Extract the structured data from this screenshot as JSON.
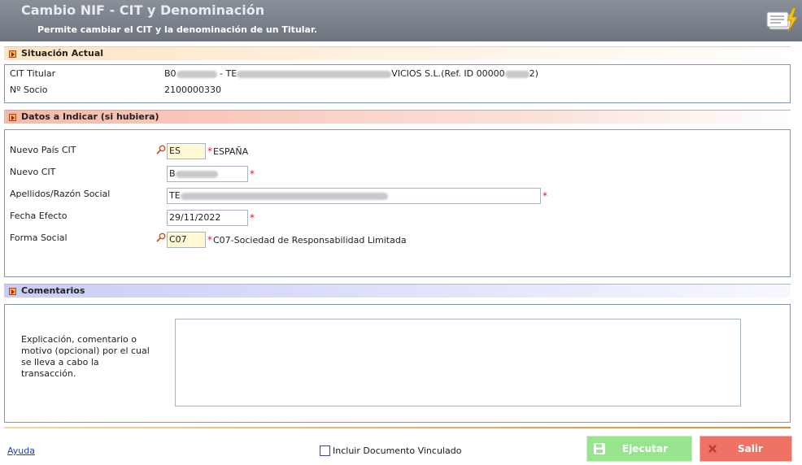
{
  "header": {
    "title": "Cambio NIF - CIT y Denominación",
    "subtitle": "Permite cambiar el CIT y la denominación de un Titular."
  },
  "situacion": {
    "title": "Situación Actual",
    "cit_label": "CIT Titular",
    "cit_value_a": "B0",
    "cit_value_b": " - TE",
    "cit_value_c": "VICIOS S.L.(Ref. ID 00000",
    "cit_value_d": "2)",
    "socio_label": "Nº Socio",
    "socio_value": "2100000330"
  },
  "datos": {
    "title": "Datos a Indicar (si hubiera)",
    "pais_label": "Nuevo País CIT",
    "pais_value": "ES",
    "pais_desc": "ESPAÑA",
    "cit_label": "Nuevo CIT",
    "cit_value": "B",
    "apellidos_label": "Apellidos/Razón Social",
    "apellidos_value": "TE",
    "fecha_label": "Fecha Efecto",
    "fecha_value": "29/11/2022",
    "forma_label": "Forma Social",
    "forma_value": "C07",
    "forma_desc": "C07-Sociedad de Responsabilidad Limitada"
  },
  "comentarios": {
    "title": "Comentarios",
    "label": "Explicación, comentario o motivo (opcional) por el cual se lleva a cabo la transacción.",
    "value": ""
  },
  "footer": {
    "help_link": "Ayuda",
    "checkbox_label": "Incluir Documento Vinculado",
    "execute_label": "Ejecutar",
    "exit_label": "Salir"
  },
  "icons": {
    "header": "documents-lightning-icon",
    "lookup": "magnifier-icon",
    "execute": "floppy-disk-icon",
    "exit": "close-icon"
  },
  "colors": {
    "header_bg": "#7b828c",
    "execute_bg": "#97e68f",
    "exit_bg": "#ee7366",
    "required": "#d0202a",
    "lookup_field_bg": "#fff9d6"
  }
}
